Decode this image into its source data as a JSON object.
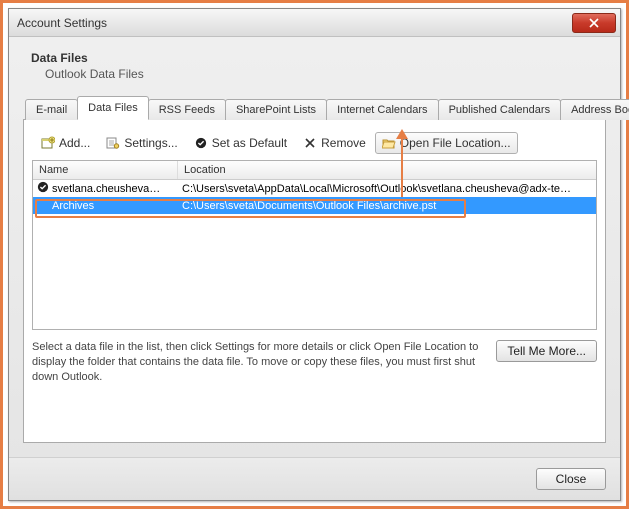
{
  "window": {
    "title": "Account Settings"
  },
  "header": {
    "title": "Data Files",
    "subtitle": "Outlook Data Files"
  },
  "tabs": [
    {
      "label": "E-mail"
    },
    {
      "label": "Data Files"
    },
    {
      "label": "RSS Feeds"
    },
    {
      "label": "SharePoint Lists"
    },
    {
      "label": "Internet Calendars"
    },
    {
      "label": "Published Calendars"
    },
    {
      "label": "Address Books"
    }
  ],
  "active_tab_index": 1,
  "toolbar": {
    "add": "Add...",
    "settings": "Settings...",
    "set_default": "Set as Default",
    "remove": "Remove",
    "open_location": "Open File Location..."
  },
  "columns": {
    "name": "Name",
    "location": "Location"
  },
  "rows": [
    {
      "name": "svetlana.cheusheva…",
      "location": "C:\\Users\\sveta\\AppData\\Local\\Microsoft\\Outlook\\svetlana.cheusheva@adx-te…",
      "default": true,
      "selected": false
    },
    {
      "name": "Archives",
      "location": "C:\\Users\\sveta\\Documents\\Outlook Files\\archive.pst",
      "default": false,
      "selected": true
    }
  ],
  "help_text": "Select a data file in the list, then click Settings for more details or click Open File Location to display the folder that contains the data file. To move or copy these files, you must first shut down Outlook.",
  "buttons": {
    "tell_me_more": "Tell Me More...",
    "close": "Close"
  },
  "colors": {
    "accent": "#e67e45",
    "highlight": "#3399ff"
  }
}
